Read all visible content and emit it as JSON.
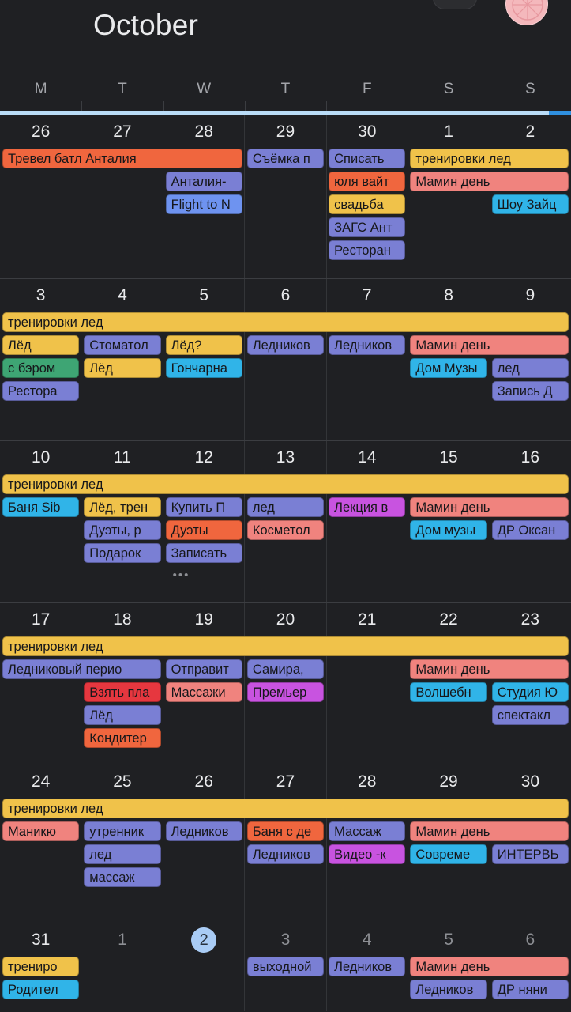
{
  "header": {
    "month_title": "October",
    "avatar_icon": "user-avatar-pink",
    "menu_pill_icon": "pill-button"
  },
  "weekdays": [
    "M",
    "T",
    "W",
    "T",
    "F",
    "S",
    "S"
  ],
  "colors": {
    "background": "#1f2023",
    "grid_line": "#333538",
    "today_circle": "#a9ccf5",
    "scroll_track": "#b9dcf7",
    "scroll_thumb": "#2f90e0",
    "chip_orange": "#f0663e",
    "chip_orange_soft": "#f4713f",
    "chip_yellow": "#f0c24a",
    "chip_purple_blue": "#7a7fd4",
    "chip_blue": "#6e93f0",
    "chip_cyan": "#30b4e8",
    "chip_salmon": "#f0837e",
    "chip_green": "#3ea574",
    "chip_magenta": "#c853e0",
    "chip_red": "#e6373f",
    "chip_text": "#16171a"
  },
  "weeks": [
    {
      "days": [
        {
          "num": "26",
          "dim": false
        },
        {
          "num": "27",
          "dim": false
        },
        {
          "num": "28",
          "dim": false
        },
        {
          "num": "29",
          "dim": false
        },
        {
          "num": "30",
          "dim": false
        },
        {
          "num": "1",
          "dim": false
        },
        {
          "num": "2",
          "dim": false
        }
      ],
      "lanes": 5,
      "events": [
        {
          "label": "Тревел батл Анталия",
          "start": 0,
          "span": 3,
          "lane": 0,
          "color": "chip_orange"
        },
        {
          "label": "Съёмка п",
          "start": 3,
          "span": 1,
          "lane": 0,
          "color": "chip_purple_blue"
        },
        {
          "label": "Списать",
          "start": 4,
          "span": 1,
          "lane": 0,
          "color": "chip_purple_blue"
        },
        {
          "label": "тренировки лед",
          "start": 5,
          "span": 2,
          "lane": 0,
          "color": "chip_yellow"
        },
        {
          "label": "Анталия-",
          "start": 2,
          "span": 1,
          "lane": 1,
          "color": "chip_purple_blue"
        },
        {
          "label": "юля вайт",
          "start": 4,
          "span": 1,
          "lane": 1,
          "color": "chip_orange"
        },
        {
          "label": "Мамин день",
          "start": 5,
          "span": 2,
          "lane": 1,
          "color": "chip_salmon"
        },
        {
          "label": "Flight to N",
          "start": 2,
          "span": 1,
          "lane": 2,
          "color": "chip_blue"
        },
        {
          "label": "свадьба",
          "start": 4,
          "span": 1,
          "lane": 2,
          "color": "chip_yellow"
        },
        {
          "label": "Шоу Зайц",
          "start": 6,
          "span": 1,
          "lane": 2,
          "color": "chip_cyan"
        },
        {
          "label": "ЗАГС Ант",
          "start": 4,
          "span": 1,
          "lane": 3,
          "color": "chip_purple_blue"
        },
        {
          "label": "Ресторан",
          "start": 4,
          "span": 1,
          "lane": 4,
          "color": "chip_purple_blue"
        }
      ],
      "more": []
    },
    {
      "days": [
        {
          "num": "3",
          "dim": false
        },
        {
          "num": "4",
          "dim": false
        },
        {
          "num": "5",
          "dim": false
        },
        {
          "num": "6",
          "dim": false
        },
        {
          "num": "7",
          "dim": false
        },
        {
          "num": "8",
          "dim": false
        },
        {
          "num": "9",
          "dim": false
        }
      ],
      "lanes": 4,
      "events": [
        {
          "label": "тренировки лед",
          "start": 0,
          "span": 7,
          "lane": 0,
          "color": "chip_yellow"
        },
        {
          "label": "Лёд",
          "start": 0,
          "span": 1,
          "lane": 1,
          "color": "chip_yellow"
        },
        {
          "label": "Стоматол",
          "start": 1,
          "span": 1,
          "lane": 1,
          "color": "chip_purple_blue"
        },
        {
          "label": "Лёд?",
          "start": 2,
          "span": 1,
          "lane": 1,
          "color": "chip_yellow"
        },
        {
          "label": "Ледников",
          "start": 3,
          "span": 1,
          "lane": 1,
          "color": "chip_purple_blue"
        },
        {
          "label": "Ледников",
          "start": 4,
          "span": 1,
          "lane": 1,
          "color": "chip_purple_blue"
        },
        {
          "label": "Мамин день",
          "start": 5,
          "span": 2,
          "lane": 1,
          "color": "chip_salmon"
        },
        {
          "label": "с бэром",
          "start": 0,
          "span": 1,
          "lane": 2,
          "color": "chip_green"
        },
        {
          "label": "Лёд",
          "start": 1,
          "span": 1,
          "lane": 2,
          "color": "chip_yellow"
        },
        {
          "label": "Гончарна",
          "start": 2,
          "span": 1,
          "lane": 2,
          "color": "chip_cyan"
        },
        {
          "label": "Дом Музы",
          "start": 5,
          "span": 1,
          "lane": 2,
          "color": "chip_cyan"
        },
        {
          "label": "лед",
          "start": 6,
          "span": 1,
          "lane": 2,
          "color": "chip_purple_blue"
        },
        {
          "label": "Рестора",
          "start": 0,
          "span": 1,
          "lane": 3,
          "color": "chip_purple_blue"
        },
        {
          "label": "Запись Д",
          "start": 6,
          "span": 1,
          "lane": 3,
          "color": "chip_purple_blue"
        }
      ],
      "more": []
    },
    {
      "days": [
        {
          "num": "10",
          "dim": false
        },
        {
          "num": "11",
          "dim": false
        },
        {
          "num": "12",
          "dim": false
        },
        {
          "num": "13",
          "dim": false
        },
        {
          "num": "14",
          "dim": false
        },
        {
          "num": "15",
          "dim": false
        },
        {
          "num": "16",
          "dim": false
        }
      ],
      "lanes": 4,
      "events": [
        {
          "label": "тренировки лед",
          "start": 0,
          "span": 7,
          "lane": 0,
          "color": "chip_yellow"
        },
        {
          "label": "Баня Sib",
          "start": 0,
          "span": 1,
          "lane": 1,
          "color": "chip_cyan"
        },
        {
          "label": "Лёд, трен",
          "start": 1,
          "span": 1,
          "lane": 1,
          "color": "chip_yellow"
        },
        {
          "label": "Купить П",
          "start": 2,
          "span": 1,
          "lane": 1,
          "color": "chip_purple_blue"
        },
        {
          "label": "лед",
          "start": 3,
          "span": 1,
          "lane": 1,
          "color": "chip_purple_blue"
        },
        {
          "label": "Лекция в",
          "start": 4,
          "span": 1,
          "lane": 1,
          "color": "chip_magenta"
        },
        {
          "label": "Мамин день",
          "start": 5,
          "span": 2,
          "lane": 1,
          "color": "chip_salmon"
        },
        {
          "label": "Дуэты, р",
          "start": 1,
          "span": 1,
          "lane": 2,
          "color": "chip_purple_blue"
        },
        {
          "label": "Дуэты",
          "start": 2,
          "span": 1,
          "lane": 2,
          "color": "chip_orange"
        },
        {
          "label": "Косметол",
          "start": 3,
          "span": 1,
          "lane": 2,
          "color": "chip_salmon"
        },
        {
          "label": "Дом музы",
          "start": 5,
          "span": 1,
          "lane": 2,
          "color": "chip_cyan"
        },
        {
          "label": "ДР Оксан",
          "start": 6,
          "span": 1,
          "lane": 2,
          "color": "chip_purple_blue"
        },
        {
          "label": "Подарок",
          "start": 1,
          "span": 1,
          "lane": 3,
          "color": "chip_purple_blue"
        },
        {
          "label": "Записать",
          "start": 2,
          "span": 1,
          "lane": 3,
          "color": "chip_purple_blue"
        }
      ],
      "more": [
        {
          "day": 2,
          "lane": 4,
          "label": "•••"
        }
      ]
    },
    {
      "days": [
        {
          "num": "17",
          "dim": false
        },
        {
          "num": "18",
          "dim": false
        },
        {
          "num": "19",
          "dim": false
        },
        {
          "num": "20",
          "dim": false
        },
        {
          "num": "21",
          "dim": false
        },
        {
          "num": "22",
          "dim": false
        },
        {
          "num": "23",
          "dim": false
        }
      ],
      "lanes": 5,
      "events": [
        {
          "label": "тренировки лед",
          "start": 0,
          "span": 7,
          "lane": 0,
          "color": "chip_yellow"
        },
        {
          "label": "Ледниковый перио",
          "start": 0,
          "span": 2,
          "lane": 1,
          "color": "chip_purple_blue"
        },
        {
          "label": "Отправит",
          "start": 2,
          "span": 1,
          "lane": 1,
          "color": "chip_purple_blue"
        },
        {
          "label": "Самира,",
          "start": 3,
          "span": 1,
          "lane": 1,
          "color": "chip_purple_blue"
        },
        {
          "label": "Мамин день",
          "start": 5,
          "span": 2,
          "lane": 1,
          "color": "chip_salmon"
        },
        {
          "label": "Взять пла",
          "start": 1,
          "span": 1,
          "lane": 2,
          "color": "chip_red"
        },
        {
          "label": "Массажи",
          "start": 2,
          "span": 1,
          "lane": 2,
          "color": "chip_salmon"
        },
        {
          "label": "Премьер",
          "start": 3,
          "span": 1,
          "lane": 2,
          "color": "chip_magenta"
        },
        {
          "label": "Волшебн",
          "start": 5,
          "span": 1,
          "lane": 2,
          "color": "chip_cyan"
        },
        {
          "label": "Студия Ю",
          "start": 6,
          "span": 1,
          "lane": 2,
          "color": "chip_cyan"
        },
        {
          "label": "Лёд",
          "start": 1,
          "span": 1,
          "lane": 3,
          "color": "chip_purple_blue"
        },
        {
          "label": "спектакл",
          "start": 6,
          "span": 1,
          "lane": 3,
          "color": "chip_purple_blue"
        },
        {
          "label": "Кондитер",
          "start": 1,
          "span": 1,
          "lane": 4,
          "color": "chip_orange"
        }
      ],
      "more": []
    },
    {
      "days": [
        {
          "num": "24",
          "dim": false
        },
        {
          "num": "25",
          "dim": false
        },
        {
          "num": "26",
          "dim": false
        },
        {
          "num": "27",
          "dim": false
        },
        {
          "num": "28",
          "dim": false
        },
        {
          "num": "29",
          "dim": false
        },
        {
          "num": "30",
          "dim": false
        }
      ],
      "lanes": 4,
      "events": [
        {
          "label": "тренировки лед",
          "start": 0,
          "span": 7,
          "lane": 0,
          "color": "chip_yellow"
        },
        {
          "label": "Маникю",
          "start": 0,
          "span": 1,
          "lane": 1,
          "color": "chip_salmon"
        },
        {
          "label": "утренник",
          "start": 1,
          "span": 1,
          "lane": 1,
          "color": "chip_purple_blue"
        },
        {
          "label": "Ледников",
          "start": 2,
          "span": 1,
          "lane": 1,
          "color": "chip_purple_blue"
        },
        {
          "label": "Баня с де",
          "start": 3,
          "span": 1,
          "lane": 1,
          "color": "chip_orange"
        },
        {
          "label": "Массаж",
          "start": 4,
          "span": 1,
          "lane": 1,
          "color": "chip_purple_blue"
        },
        {
          "label": "Мамин день",
          "start": 5,
          "span": 2,
          "lane": 1,
          "color": "chip_salmon"
        },
        {
          "label": "лед",
          "start": 1,
          "span": 1,
          "lane": 2,
          "color": "chip_purple_blue"
        },
        {
          "label": "Ледников",
          "start": 3,
          "span": 1,
          "lane": 2,
          "color": "chip_purple_blue"
        },
        {
          "label": "Видео -к",
          "start": 4,
          "span": 1,
          "lane": 2,
          "color": "chip_magenta"
        },
        {
          "label": "Совреме",
          "start": 5,
          "span": 1,
          "lane": 2,
          "color": "chip_cyan"
        },
        {
          "label": "ИНТЕРВЬ",
          "start": 6,
          "span": 1,
          "lane": 2,
          "color": "chip_purple_blue"
        },
        {
          "label": "массаж",
          "start": 1,
          "span": 1,
          "lane": 3,
          "color": "chip_purple_blue"
        }
      ],
      "more": []
    },
    {
      "days": [
        {
          "num": "31",
          "dim": false
        },
        {
          "num": "1",
          "dim": true
        },
        {
          "num": "2",
          "dim": false,
          "today": true
        },
        {
          "num": "3",
          "dim": true
        },
        {
          "num": "4",
          "dim": true
        },
        {
          "num": "5",
          "dim": true
        },
        {
          "num": "6",
          "dim": true
        }
      ],
      "lanes": 2,
      "events": [
        {
          "label": "трениро",
          "start": 0,
          "span": 1,
          "lane": 0,
          "color": "chip_yellow"
        },
        {
          "label": "выходной",
          "start": 3,
          "span": 1,
          "lane": 0,
          "color": "chip_purple_blue"
        },
        {
          "label": "Ледников",
          "start": 4,
          "span": 1,
          "lane": 0,
          "color": "chip_purple_blue"
        },
        {
          "label": "Мамин день",
          "start": 5,
          "span": 2,
          "lane": 0,
          "color": "chip_salmon"
        },
        {
          "label": "Родител",
          "start": 0,
          "span": 1,
          "lane": 1,
          "color": "chip_cyan"
        },
        {
          "label": "Ледников",
          "start": 5,
          "span": 1,
          "lane": 1,
          "color": "chip_purple_blue"
        },
        {
          "label": "ДР няни",
          "start": 6,
          "span": 1,
          "lane": 1,
          "color": "chip_purple_blue"
        }
      ],
      "more": []
    }
  ]
}
